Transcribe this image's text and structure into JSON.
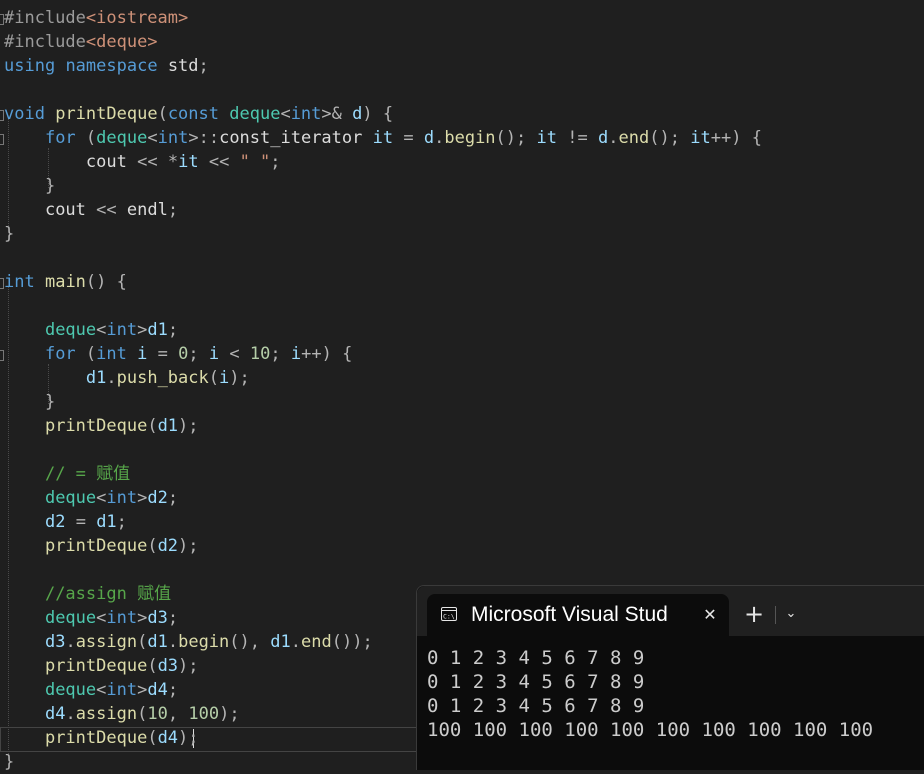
{
  "editor": {
    "lines": [
      "#include<iostream>",
      "#include<deque>",
      "using namespace std;",
      "",
      "void printDeque(const deque<int>& d) {",
      "    for (deque<int>::const_iterator it = d.begin(); it != d.end(); it++) {",
      "        cout << *it << \" \";",
      "    }",
      "    cout << endl;",
      "}",
      "",
      "int main() {",
      "",
      "    deque<int>d1;",
      "    for (int i = 0; i < 10; i++) {",
      "        d1.push_back(i);",
      "    }",
      "    printDeque(d1);",
      "",
      "    // = 赋值",
      "    deque<int>d2;",
      "    d2 = d1;",
      "    printDeque(d2);",
      "",
      "    //assign 赋值",
      "    deque<int>d3;",
      "    d3.assign(d1.begin(), d1.end());",
      "    printDeque(d3);",
      "    deque<int>d4;",
      "    d4.assign(10, 100);",
      "    printDeque(d4);",
      "}"
    ]
  },
  "terminal": {
    "tab_title": "Microsoft Visual Stud",
    "close_glyph": "✕",
    "new_tab_glyph": "+",
    "dropdown_glyph": "⌄",
    "icon": "console-icon",
    "output": [
      "0 1 2 3 4 5 6 7 8 9",
      "0 1 2 3 4 5 6 7 8 9",
      "0 1 2 3 4 5 6 7 8 9",
      "100 100 100 100 100 100 100 100 100 100"
    ]
  },
  "colors": {
    "editor_bg": "#1f1f1f",
    "keyword": "#569cd6",
    "type": "#4ec9b0",
    "function": "#dcdcaa",
    "variable": "#9cdcfe",
    "number": "#b5cea8",
    "comment": "#57a64a",
    "string": "#ce9178",
    "terminal_bg": "#0c0c0c"
  }
}
